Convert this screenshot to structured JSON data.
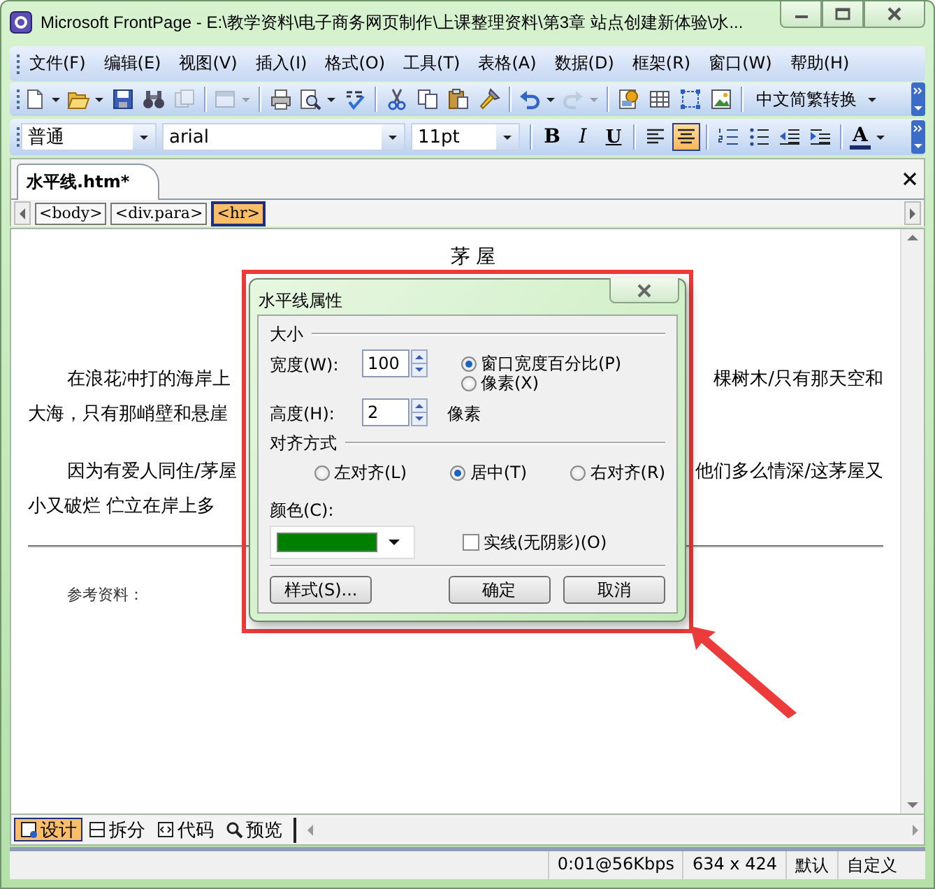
{
  "window": {
    "title": "Microsoft FrontPage - E:\\教学资料\\电子商务网页制作\\上课整理资料\\第3章 站点创建新体验\\水..."
  },
  "menu": [
    "文件(F)",
    "编辑(E)",
    "视图(V)",
    "插入(I)",
    "格式(O)",
    "工具(T)",
    "表格(A)",
    "数据(D)",
    "框架(R)",
    "窗口(W)",
    "帮助(H)"
  ],
  "standard_toolbar": {
    "buttons": [
      {
        "kind": "new",
        "disabled": false,
        "menu": true
      },
      {
        "kind": "open",
        "disabled": false,
        "menu": true
      },
      {
        "kind": "save",
        "disabled": false,
        "menu": false
      },
      {
        "kind": "find",
        "disabled": false,
        "menu": false
      },
      {
        "kind": "publish",
        "disabled": true,
        "menu": false
      },
      {
        "kind": "separator"
      },
      {
        "kind": "panel",
        "disabled": true,
        "menu": true
      },
      {
        "kind": "separator"
      },
      {
        "kind": "print",
        "disabled": false,
        "menu": false
      },
      {
        "kind": "preview",
        "disabled": false,
        "menu": true
      },
      {
        "kind": "spelling",
        "disabled": false,
        "menu": false
      },
      {
        "kind": "separator"
      },
      {
        "kind": "cut",
        "disabled": false,
        "menu": false
      },
      {
        "kind": "copy",
        "disabled": false,
        "menu": false
      },
      {
        "kind": "paste",
        "disabled": false,
        "menu": false
      },
      {
        "kind": "painter",
        "disabled": false,
        "menu": false
      },
      {
        "kind": "separator"
      },
      {
        "kind": "undo",
        "disabled": false,
        "menu": true
      },
      {
        "kind": "redo",
        "disabled": true,
        "menu": true
      },
      {
        "kind": "separator"
      },
      {
        "kind": "component",
        "disabled": false,
        "menu": false
      },
      {
        "kind": "table",
        "disabled": false,
        "menu": false
      },
      {
        "kind": "layer",
        "disabled": false,
        "menu": false
      },
      {
        "kind": "picture",
        "disabled": false,
        "menu": false
      },
      {
        "kind": "separator"
      }
    ],
    "convert_button": "中文简繁转换"
  },
  "format_toolbar": {
    "style": "普通",
    "font": "arial",
    "size": "11pt",
    "buttons": [
      {
        "kind": "bold",
        "label": "B",
        "selected": false
      },
      {
        "kind": "italic",
        "label": "I",
        "selected": false
      },
      {
        "kind": "underline",
        "label": "U",
        "selected": false
      },
      {
        "kind": "separator"
      },
      {
        "kind": "align-left",
        "selected": false
      },
      {
        "kind": "align-center",
        "selected": true
      },
      {
        "kind": "separator"
      },
      {
        "kind": "numbering",
        "selected": false
      },
      {
        "kind": "bullets",
        "selected": false
      },
      {
        "kind": "outdent",
        "selected": false
      },
      {
        "kind": "indent",
        "selected": false
      },
      {
        "kind": "separator"
      },
      {
        "kind": "font-color",
        "label": "A",
        "selected": false
      }
    ]
  },
  "document_tab": {
    "label": "水平线.htm*"
  },
  "tag_path": [
    {
      "label": "<body>",
      "selected": false
    },
    {
      "label": "<div.para>",
      "selected": false
    },
    {
      "label": "<hr>",
      "selected": true
    }
  ],
  "document": {
    "heading": "茅 屋",
    "paragraphs": [
      {
        "lines": [
          {
            "left": "在浪花冲打的海岸上",
            "right": "棵树木/只有那天空和"
          },
          {
            "left": "大海，只有那峭壁和悬崖"
          }
        ]
      },
      {
        "lines": [
          {
            "left": "因为有爱人同住/茅屋",
            "right": "他们多么情深/这茅屋又"
          },
          {
            "left": "小又破烂 伫立在岸上多"
          }
        ]
      }
    ],
    "reference": "参考资料："
  },
  "dialog": {
    "title": "水平线属性",
    "size_group": "大小",
    "width_label": "宽度(W):",
    "width_value": "100",
    "width_units": [
      {
        "label": "窗口宽度百分比(P)",
        "selected": true
      },
      {
        "label": "像素(X)",
        "selected": false
      }
    ],
    "height_label": "高度(H):",
    "height_value": "2",
    "height_unit": "像素",
    "align_group": "对齐方式",
    "align_options": [
      {
        "label": "左对齐(L)",
        "selected": false
      },
      {
        "label": "居中(T)",
        "selected": true
      },
      {
        "label": "右对齐(R)",
        "selected": false
      }
    ],
    "color_field": {
      "label": "颜色(C):",
      "color": "#008000"
    },
    "solid_line": {
      "label": "实线(无阴影)(O)",
      "checked": false
    },
    "buttons": [
      "样式(S)...",
      "确定",
      "取消"
    ]
  },
  "view_tabs": [
    {
      "label": "设计",
      "kind": "design",
      "selected": true
    },
    {
      "label": "拆分",
      "kind": "split",
      "selected": false
    },
    {
      "label": "代码",
      "kind": "code",
      "selected": false
    },
    {
      "label": "预览",
      "kind": "preview",
      "selected": false
    }
  ],
  "status_bar": [
    "0:01@56Kbps",
    "634 x 424",
    "默认",
    "自定义"
  ]
}
